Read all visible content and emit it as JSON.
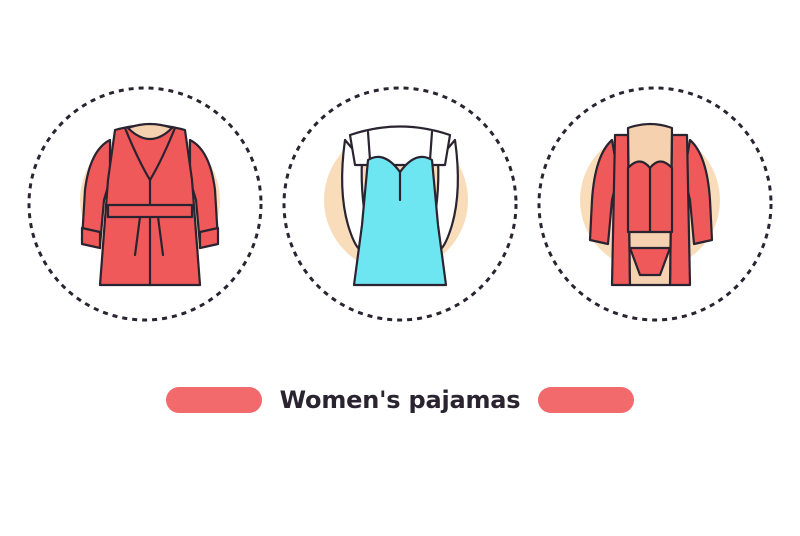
{
  "title": "Women's pajamas",
  "items": [
    {
      "name": "robe-icon"
    },
    {
      "name": "nightgown-icon"
    },
    {
      "name": "lingerie-robe-icon"
    }
  ],
  "colors": {
    "accent": "#f26a6b",
    "garment_red": "#f0595a",
    "garment_blue": "#6ee6f2",
    "backdrop": "#f9ddbb",
    "outline": "#2a2330",
    "dotted_ring": "#2a2330"
  }
}
